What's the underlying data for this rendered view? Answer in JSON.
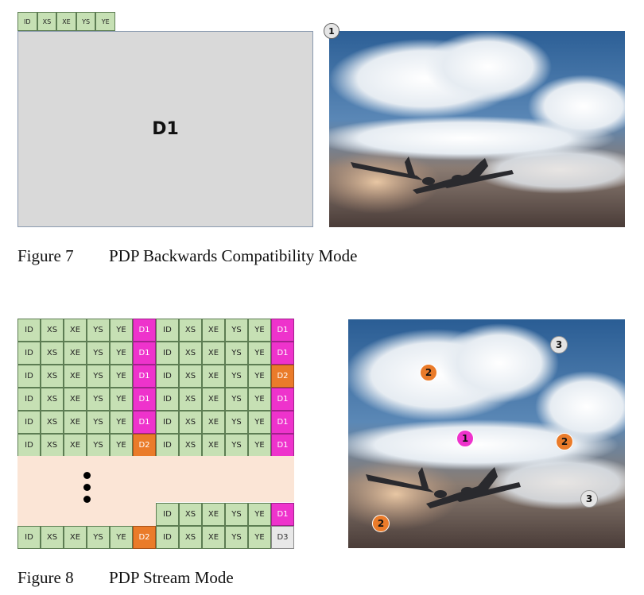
{
  "figure7": {
    "header_fields": [
      "ID",
      "XS",
      "XE",
      "YS",
      "YE"
    ],
    "data_block": "D1",
    "marker": "1",
    "caption_number": "Figure 7",
    "caption_title": "PDP Backwards Compatibility Mode"
  },
  "figure8": {
    "rows": [
      [
        "ID",
        "XS",
        "XE",
        "YS",
        "YE",
        "D1",
        "ID",
        "XS",
        "XE",
        "YS",
        "YE",
        "D1"
      ],
      [
        "ID",
        "XS",
        "XE",
        "YS",
        "YE",
        "D1",
        "ID",
        "XS",
        "XE",
        "YS",
        "YE",
        "D1"
      ],
      [
        "ID",
        "XS",
        "XE",
        "YS",
        "YE",
        "D1",
        "ID",
        "XS",
        "XE",
        "YS",
        "YE",
        "D2"
      ],
      [
        "ID",
        "XS",
        "XE",
        "YS",
        "YE",
        "D1",
        "ID",
        "XS",
        "XE",
        "YS",
        "YE",
        "D1"
      ],
      [
        "ID",
        "XS",
        "XE",
        "YS",
        "YE",
        "D1",
        "ID",
        "XS",
        "XE",
        "YS",
        "YE",
        "D1"
      ],
      [
        "ID",
        "XS",
        "XE",
        "YS",
        "YE",
        "D2",
        "ID",
        "XS",
        "XE",
        "YS",
        "YE",
        "D1"
      ]
    ],
    "partial_row": [
      "ID",
      "XS",
      "XE",
      "YS",
      "YE",
      "D1"
    ],
    "last_row": [
      "ID",
      "XS",
      "XE",
      "YS",
      "YE",
      "D2",
      "ID",
      "XS",
      "XE",
      "YS",
      "YE",
      "D3"
    ],
    "markers": [
      "1",
      "2",
      "2",
      "2",
      "3",
      "3"
    ],
    "caption_number": "Figure 8",
    "caption_title": "PDP Stream Mode"
  },
  "colors": {
    "header_cell": "#c6e0b4",
    "d1": "#ee33cc",
    "d2": "#ea7b2a",
    "d3": "#e8e8e8",
    "blank": "#fbe5d6"
  }
}
